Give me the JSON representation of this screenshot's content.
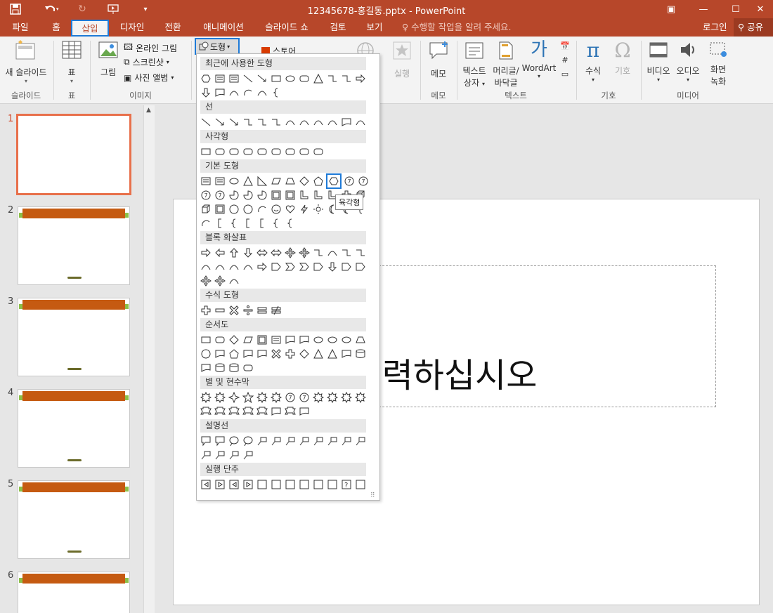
{
  "window": {
    "title": "12345678-홍길동.pptx - PowerPoint",
    "controls": {
      "restore": "▣",
      "minimize": "—",
      "maximize": "☐",
      "close": "✕"
    }
  },
  "quick_access": {
    "save_icon": "save-icon",
    "undo_icon": "undo-icon",
    "redo_icon": "redo-icon",
    "present_icon": "present-icon",
    "customize_icon": "customize-icon"
  },
  "tabs": [
    {
      "label": "파일"
    },
    {
      "label": "홈"
    },
    {
      "label": "삽입",
      "active": true
    },
    {
      "label": "디자인"
    },
    {
      "label": "전환"
    },
    {
      "label": "애니메이션"
    },
    {
      "label": "슬라이드 쇼"
    },
    {
      "label": "검토"
    },
    {
      "label": "보기"
    }
  ],
  "tell_me": "수행할 작업을 알려 주세요.",
  "signin": "로그인",
  "share": "공유",
  "ribbon": {
    "new_slide": "새 슬라이드",
    "table": "표",
    "picture": "그림",
    "online_picture": "온라인 그림",
    "screenshot": "스크린샷",
    "photo_album": "사진 앨범",
    "shapes": "도형",
    "store": "스토어",
    "action_partial": "크",
    "action": "실행",
    "comment": "메모",
    "textbox": "텍스트 상자",
    "textbox_line2": "상자",
    "textbox_line1": "텍스트",
    "header_footer_1": "머리글/",
    "header_footer_2": "바닥글",
    "wordart": "WordArt",
    "equation": "수식",
    "symbol": "기호",
    "video": "비디오",
    "audio": "오디오",
    "screen_rec_1": "화면",
    "screen_rec_2": "녹화",
    "groups": {
      "slides": "슬라이드",
      "tables": "표",
      "images": "이미지",
      "comments": "메모",
      "text": "텍스트",
      "symbols": "기호",
      "media": "미디어"
    }
  },
  "shapes_menu": {
    "categories": [
      "최근에 사용한 도형",
      "선",
      "사각형",
      "기본 도형",
      "블록 화살표",
      "수식 도형",
      "순서도",
      "별 및 현수막",
      "설명선",
      "실행 단추"
    ],
    "tooltip": "육각형"
  },
  "slides": [
    {
      "number": "1",
      "selected": true
    },
    {
      "number": "2"
    },
    {
      "number": "3"
    },
    {
      "number": "4"
    },
    {
      "number": "5"
    },
    {
      "number": "6"
    }
  ],
  "main_slide": {
    "placeholder_text": "을 입력하십시오"
  },
  "colors": {
    "accent": "#b7472a",
    "highlight": "#1e7ad7",
    "thumb_band": "#c55a11",
    "thumb_green": "#8cc04a",
    "selected_slide": "#e8704b"
  }
}
